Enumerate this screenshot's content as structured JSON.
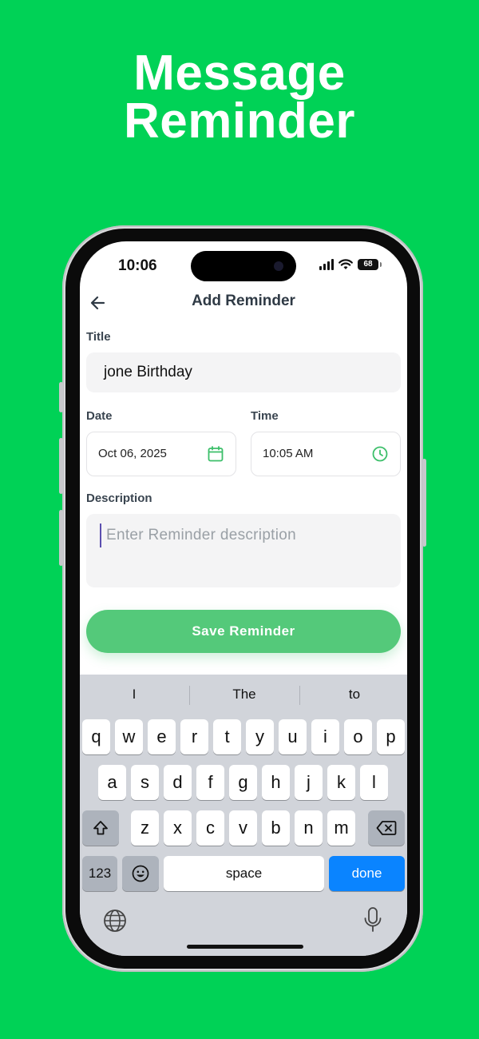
{
  "promo": {
    "title_line1": "Message",
    "title_line2": "Reminder"
  },
  "status_bar": {
    "time": "10:06",
    "battery": "68"
  },
  "header": {
    "title": "Add Reminder"
  },
  "form": {
    "title_label": "Title",
    "title_value": "jone Birthday",
    "date_label": "Date",
    "date_value": "Oct 06, 2025",
    "time_label": "Time",
    "time_value": "10:05 AM",
    "description_label": "Description",
    "description_placeholder": "Enter Reminder description",
    "save_label": "Save Reminder"
  },
  "keyboard": {
    "suggestions": [
      "I",
      "The",
      "to"
    ],
    "row1": [
      "q",
      "w",
      "e",
      "r",
      "t",
      "y",
      "u",
      "i",
      "o",
      "p"
    ],
    "row2": [
      "a",
      "s",
      "d",
      "f",
      "g",
      "h",
      "j",
      "k",
      "l"
    ],
    "row3": [
      "z",
      "x",
      "c",
      "v",
      "b",
      "n",
      "m"
    ],
    "numbers_label": "123",
    "space_label": "space",
    "done_label": "done"
  },
  "colors": {
    "background": "#00D256",
    "accent": "#54C97A",
    "keyboard_blue": "#0a84ff"
  }
}
